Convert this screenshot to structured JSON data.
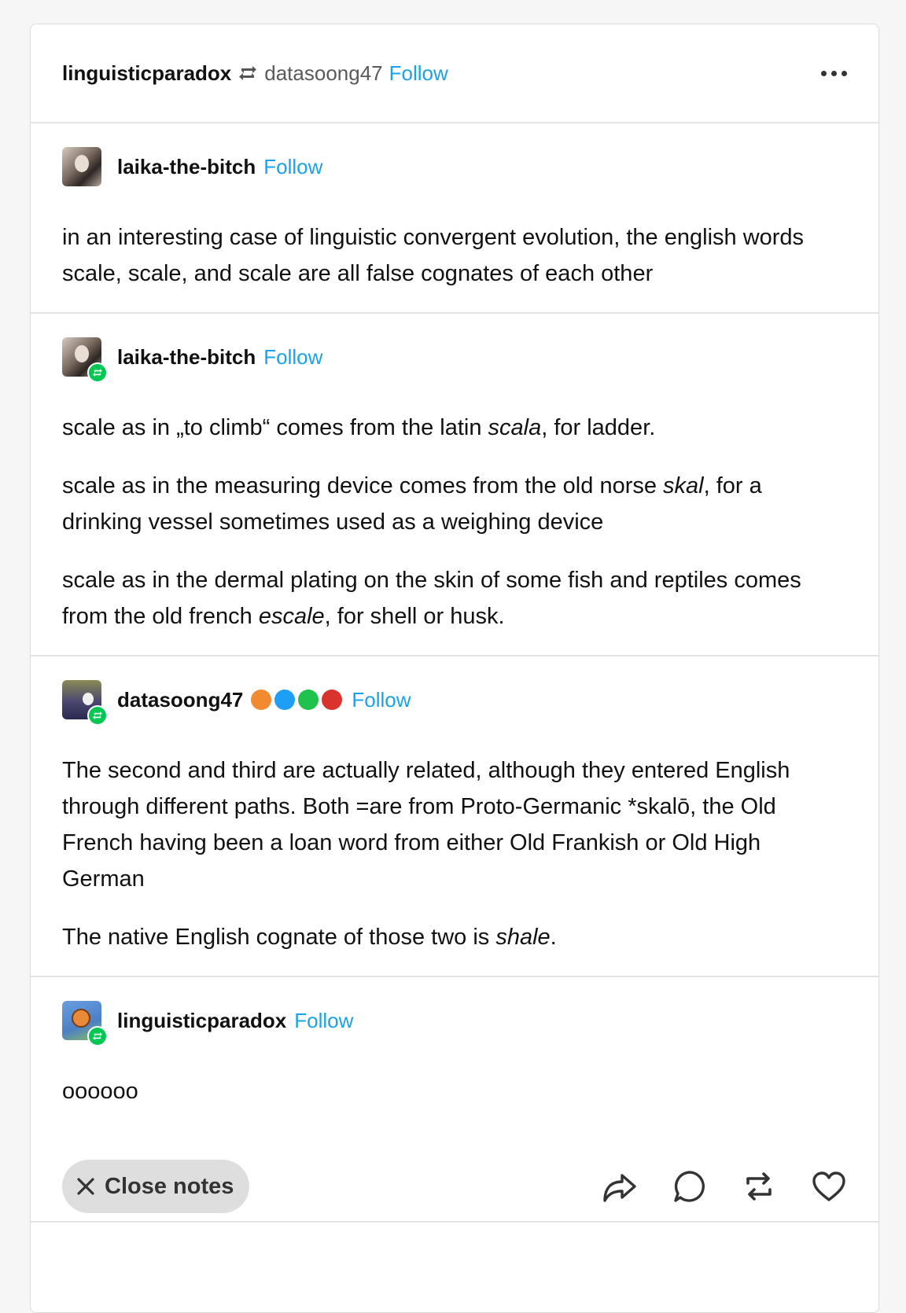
{
  "header": {
    "user": "linguisticparadox",
    "via": "datasoong47",
    "follow": "Follow"
  },
  "posts": [
    {
      "name": "laika-the-bitch",
      "follow": "Follow",
      "paragraphs": [
        "in an interesting case of linguistic convergent evolution, the english words scale, scale, and scale are all false cognates of each other"
      ]
    },
    {
      "name": "laika-the-bitch",
      "follow": "Follow",
      "p1": {
        "a": "scale as in „to climb“ comes from the latin ",
        "i": "scala",
        "b": ", for ladder."
      },
      "p2": {
        "a": "scale as in the measuring device comes from the old norse ",
        "i": "skal",
        "b": ", for a drinking vessel sometimes used as a weighing device"
      },
      "p3": {
        "a": "scale as in the dermal plating on the skin of some fish and reptiles comes from the old french ",
        "i": "escale",
        "b": ", for shell or husk."
      }
    },
    {
      "name": "datasoong47",
      "follow": "Follow",
      "p1": "The second and third are actually related, although they entered English through different paths. Both =are from Proto-Germanic *skalō, the Old French having been a loan word from either Old Frankish or Old High German",
      "p2": {
        "a": "The native English cognate of those two is ",
        "i": "shale",
        "b": "."
      }
    },
    {
      "name": "linguisticparadox",
      "follow": "Follow",
      "p1": "oooooo"
    }
  ],
  "footer": {
    "close_notes": "Close notes"
  }
}
